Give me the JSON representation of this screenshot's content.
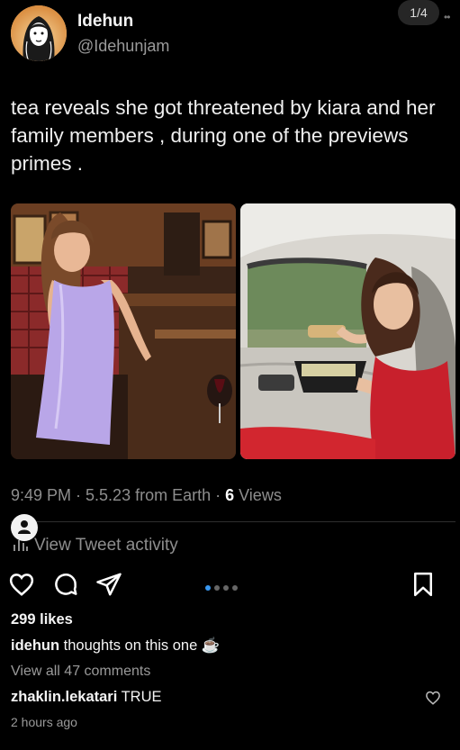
{
  "header": {
    "display_name": "Idehun",
    "handle": "@Idehunjam",
    "page_indicator": "1/4"
  },
  "tweet": {
    "text": "tea reveals she got threatened by kiara and her family members , during one of the previews primes .",
    "meta_prefix": "9:49 PM · 5.5.23 from Earth · ",
    "views_count": "6",
    "views_label": " Views",
    "activity_label": "View Tweet activity"
  },
  "post": {
    "likes": "299 likes",
    "caption_user": "idehun",
    "caption_text": " thoughts on this one ☕",
    "view_comments": "View all 47 comments",
    "comment_user": "zhaklin.lekatari",
    "comment_text": " TRUE",
    "time_ago": "2 hours ago",
    "carousel_count": 4,
    "carousel_active": 1
  },
  "colors": {
    "background": "#000000",
    "muted_text": "#8e8e8e",
    "carousel_active": "#3897f0",
    "dress_lilac": "#b9a6e8",
    "dress_red": "#c8202c"
  },
  "icons": [
    "heart-icon",
    "comment-icon",
    "share-icon",
    "bookmark-icon",
    "bar-chart-icon",
    "person-icon"
  ]
}
